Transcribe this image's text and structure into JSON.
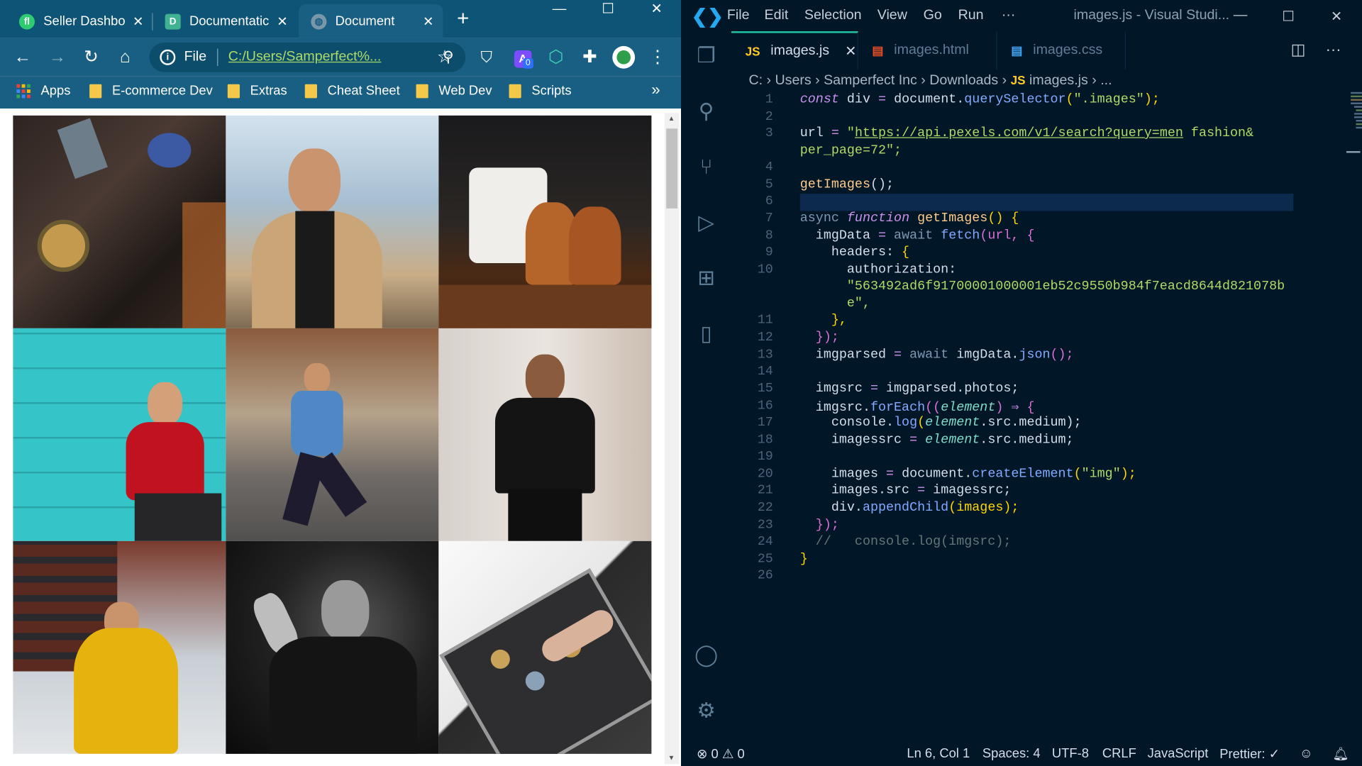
{
  "browser": {
    "tabs": [
      {
        "title": "Seller Dashbo",
        "icon": "seller-favicon"
      },
      {
        "title": "Documentatic",
        "icon": "docs-favicon"
      },
      {
        "title": "Document",
        "icon": "globe-favicon"
      }
    ],
    "address": {
      "label": "File",
      "url": "C:/Users/Samperfect%..."
    },
    "extension_badge": "0",
    "bookmarks": [
      {
        "label": "Apps"
      },
      {
        "label": "E-commerce Dev"
      },
      {
        "label": "Extras"
      },
      {
        "label": "Cheat Sheet"
      },
      {
        "label": "Web Dev"
      },
      {
        "label": "Scripts"
      }
    ],
    "bookmarks_more": "»",
    "gallery_images": [
      "man-in-suit-with-watch",
      "man-in-camel-coat",
      "shirts-and-brown-shoes",
      "man-in-red-sweater-teal-wall",
      "man-in-denim-jacket-street",
      "man-in-black-tshirt",
      "man-in-yellow-hoodie",
      "man-black-and-white-portrait",
      "watch-collection-box"
    ]
  },
  "vscode": {
    "menu": [
      "File",
      "Edit",
      "Selection",
      "View",
      "Go",
      "Run",
      "···"
    ],
    "window_title": "images.js - Visual Studi...",
    "tabs": [
      {
        "label": "images.js",
        "icon": "JS",
        "active": true
      },
      {
        "label": "images.html",
        "icon": "html",
        "active": false
      },
      {
        "label": "images.css",
        "icon": "css",
        "active": false
      }
    ],
    "breadcrumb": [
      "C:",
      "Users",
      "Samperfect Inc",
      "Downloads",
      "images.js",
      "..."
    ],
    "breadcrumb_js": "JS",
    "line_numbers": [
      "1",
      "2",
      "3",
      "",
      "4",
      "5",
      "6",
      "7",
      "8",
      "9",
      "10",
      "",
      "",
      "11",
      "12",
      "13",
      "14",
      "15",
      "16",
      "17",
      "18",
      "19",
      "20",
      "21",
      "22",
      "23",
      "24",
      "25",
      "26"
    ],
    "code": {
      "l1_a": "const",
      "l1_b": " div ",
      "l1_c": "=",
      "l1_d": " document.",
      "l1_e": "querySelector",
      "l1_f": "(",
      "l1_g": "\".images\"",
      "l1_h": ");",
      "l3_a": "url ",
      "l3_b": "= ",
      "l3_c": "\"",
      "l3_d": "https://api.pexels.com/v1/search?query=men",
      "l3_e": " fashion&",
      "l3b": "per_page=72\";",
      "l5_a": "getImages",
      "l5_b": "();",
      "l7_a": "async ",
      "l7_b": "function ",
      "l7_c": "getImages",
      "l7_d": "() {",
      "l8_a": "imgData ",
      "l8_b": "= ",
      "l8_c": "await ",
      "l8_d": "fetch",
      "l8_e": "(url, {",
      "l9_a": "headers: ",
      "l9_b": "{",
      "l10_a": "authorization:",
      "l10b": "\"563492ad6f91700001000001eb52c9550b984f7eacd8644d821078b",
      "l10c": "e\",",
      "l11": "},",
      "l12": "});",
      "l13_a": "imgparsed ",
      "l13_b": "= ",
      "l13_c": "await ",
      "l13_d": "imgData.",
      "l13_e": "json",
      "l13_f": "();",
      "l15_a": "imgsrc ",
      "l15_b": "= ",
      "l15_c": "imgparsed.photos;",
      "l16_a": "imgsrc.",
      "l16_b": "forEach",
      "l16_c": "((",
      "l16_d": "element",
      "l16_e": ") ",
      "l16_f": "⇒",
      "l16_g": " {",
      "l17_a": "console.",
      "l17_b": "log",
      "l17_c": "(",
      "l17_d": "element",
      "l17_e": ".src.medium);",
      "l18_a": "imagessrc ",
      "l18_b": "= ",
      "l18_c": "element",
      "l18_d": ".src.medium;",
      "l20_a": "images ",
      "l20_b": "= ",
      "l20_c": "document.",
      "l20_d": "createElement",
      "l20_e": "(",
      "l20_f": "\"img\"",
      "l20_g": ");",
      "l21_a": "images.src ",
      "l21_b": "= ",
      "l21_c": "imagessrc;",
      "l22_a": "div.",
      "l22_b": "appendChild",
      "l22_c": "(images);",
      "l23": "});",
      "l24": "//   console.log(imgsrc);",
      "l25": "}"
    },
    "status": {
      "errors": "0",
      "warnings": "0",
      "position": "Ln 6, Col 1",
      "spaces": "Spaces: 4",
      "encoding": "UTF-8",
      "eol": "CRLF",
      "language": "JavaScript",
      "prettier": "Prettier: ✓"
    }
  }
}
